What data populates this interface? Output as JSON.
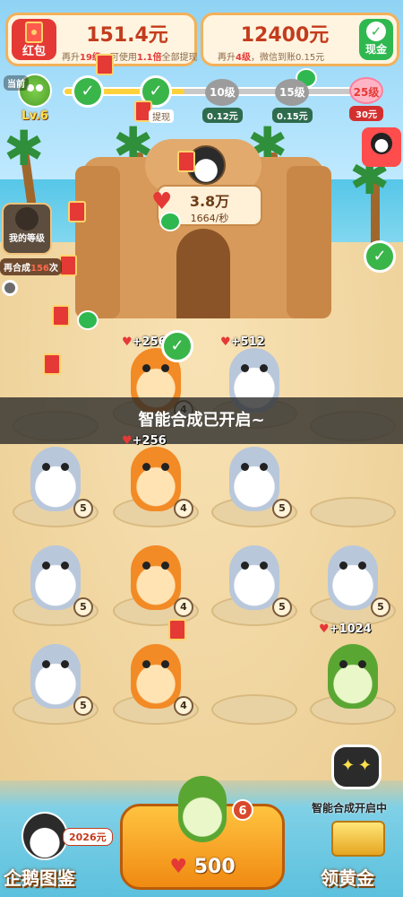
{
  "topbar": {
    "redpack": {
      "label": "红包",
      "amount": "151.4元",
      "sub_a": "再升",
      "sub_lv": "19级",
      "sub_b": "，可使用",
      "sub_x": "1.1倍",
      "sub_c": "全部提现"
    },
    "cash": {
      "amount": "12400元",
      "sub_a": "再升",
      "sub_lv": "4级",
      "sub_b": "，微信到账0.15元",
      "button": "现金"
    }
  },
  "progress": {
    "current_label": "当前",
    "level_label": "Lv.6",
    "withdraw_tag": "提现",
    "nodes": [
      {
        "label": "10级",
        "reward": "0.12元"
      },
      {
        "label": "15级",
        "reward": "0.15元"
      },
      {
        "label": "25级",
        "reward": "30元"
      }
    ]
  },
  "castle": {
    "production": "3.8万",
    "rate": "1664/秒"
  },
  "side": {
    "my_level": "我的等级",
    "merge_again_a": "再合成",
    "merge_again_n": "156",
    "merge_again_b": "次"
  },
  "grid": {
    "earn_plus_256": "+256",
    "earn_plus_512": "+512",
    "earn_plus_1024": "+1024",
    "lv4": "4",
    "lv5": "5",
    "lv6": "6"
  },
  "toast": "智能合成已开启~",
  "bottom": {
    "robot_label": "智能合成开启中",
    "buy_price": "500",
    "buy_badge": "6",
    "dex_label": "企鹅图鉴",
    "dex_tag": "2026元",
    "gold_label": "领黄金"
  }
}
